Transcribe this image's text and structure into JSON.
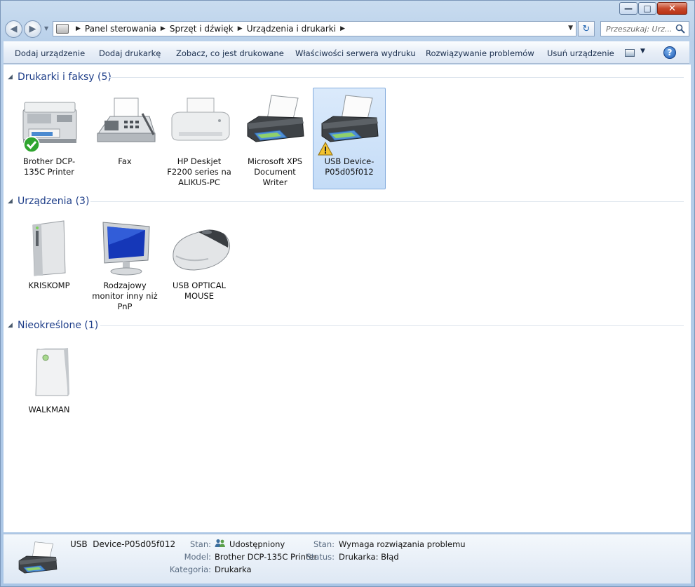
{
  "window": {
    "buttons": {
      "minimize_glyph": "—",
      "maximize_glyph": "□",
      "close_glyph": "✕"
    }
  },
  "nav": {
    "back_glyph": "◀",
    "forward_glyph": "▶",
    "breadcrumb": [
      "Panel sterowania",
      "Sprzęt i dźwięk",
      "Urządzenia i drukarki"
    ],
    "search_placeholder": "Przeszukaj: Urz...",
    "refresh_glyph": "↻"
  },
  "commands": {
    "add_device": "Dodaj urządzenie",
    "add_printer": "Dodaj drukarkę",
    "see_printing": "Zobacz, co jest drukowane",
    "server_properties": "Właściwości serwera wydruku",
    "troubleshoot": "Rozwiązywanie problemów",
    "remove_device": "Usuń urządzenie",
    "help_glyph": "?"
  },
  "groups": {
    "printers": {
      "title": "Drukarki i faksy (5)",
      "items": [
        {
          "label": "Brother DCP-135C Printer",
          "icon": "multifunction-printer-icon",
          "badge": "default-check"
        },
        {
          "label": "Fax",
          "icon": "fax-icon"
        },
        {
          "label": "HP Deskjet F2200 series na ALIKUS-PC",
          "icon": "inkjet-printer-icon"
        },
        {
          "label": "Microsoft XPS Document Writer",
          "icon": "printer-icon"
        },
        {
          "label": "USB Device-P05d05f012",
          "icon": "printer-icon",
          "badge": "warning",
          "selected": true
        }
      ]
    },
    "devices": {
      "title": "Urządzenia (3)",
      "items": [
        {
          "label": "KRISKOMP",
          "icon": "computer-tower-icon"
        },
        {
          "label": "Rodzajowy monitor inny niż PnP",
          "icon": "monitor-icon"
        },
        {
          "label": "USB OPTICAL MOUSE",
          "icon": "mouse-icon"
        }
      ]
    },
    "unspecified": {
      "title": "Nieokreślone (1)",
      "items": [
        {
          "label": "WALKMAN",
          "icon": "media-device-icon"
        }
      ]
    }
  },
  "details": {
    "name": "USB  Device-P05d05f012",
    "state_label": "Stan:",
    "state_value": "Udostępniony",
    "model_label": "Model:",
    "model_value": "Brother DCP-135C Printer",
    "category_label": "Kategoria:",
    "category_value": "Drukarka",
    "state2_label": "Stan:",
    "state2_value": "Wymaga rozwiązania problemu",
    "status_label": "Status:",
    "status_value": "Drukarka: Błąd"
  },
  "colors": {
    "group_title": "#1e3e89",
    "selection": "#c4dcf7",
    "warning": "#f2c230",
    "check": "#2fa52f"
  }
}
